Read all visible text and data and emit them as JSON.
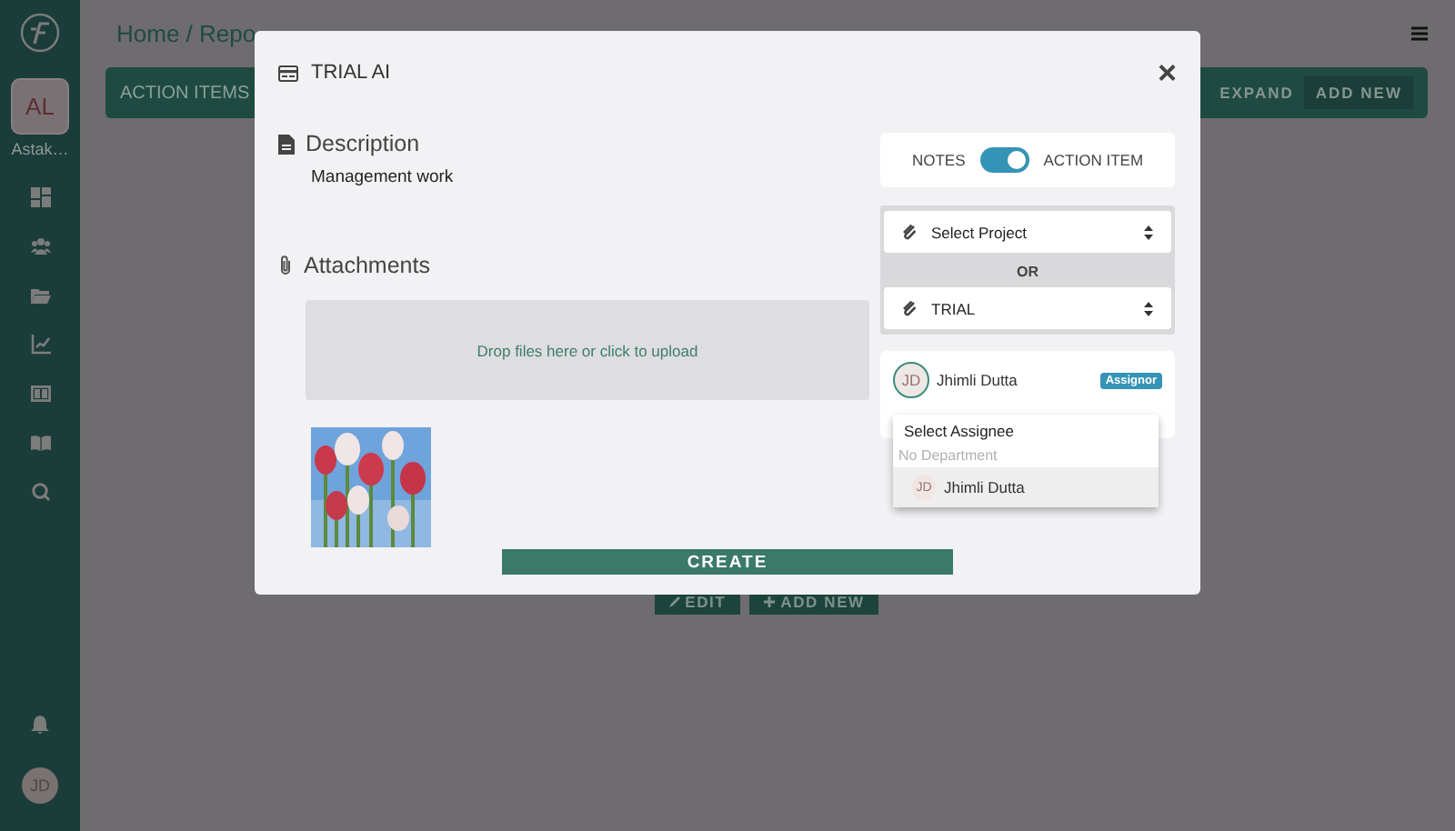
{
  "sidebar": {
    "user": {
      "initials": "AL",
      "name": "Astak…"
    },
    "footer_avatar": "JD"
  },
  "page": {
    "breadcrumb": "Home / Repo",
    "header": {
      "title": "ACTION ITEMS",
      "actions": [
        "EXPAND",
        "ADD NEW"
      ]
    },
    "buttons": [
      "EDIT",
      "ADD NEW"
    ]
  },
  "modal": {
    "title": "TRIAL AI",
    "close": "×",
    "description": {
      "label": "Description",
      "text": "Management work"
    },
    "attachments": {
      "label": "Attachments",
      "dropzone": "Drop files here or click to upload"
    },
    "type_toggle": {
      "left": "NOTES",
      "right": "ACTION ITEM",
      "on": true
    },
    "project": {
      "placeholder": "Select Project",
      "separator": "OR",
      "value": "TRIAL"
    },
    "assignor": {
      "initials": "JD",
      "name": "Jhimli Dutta",
      "badge": "Assignor"
    },
    "assignee_menu": {
      "placeholder": "Select Assignee",
      "group": "No Department",
      "options": [
        {
          "initials": "JD",
          "name": "Jhimli Dutta",
          "selected": true
        }
      ]
    },
    "submit": "CREATE"
  }
}
